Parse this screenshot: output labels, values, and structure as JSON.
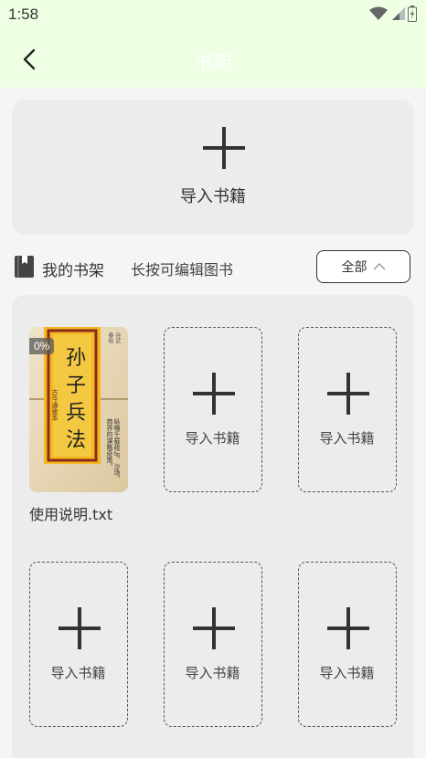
{
  "status_bar": {
    "time": "1:58"
  },
  "header": {
    "title": "书架"
  },
  "import_card": {
    "label": "导入书籍"
  },
  "shelf": {
    "title": "我的书架",
    "hint": "长按可编辑图书",
    "filter_label": "全部"
  },
  "books": [
    {
      "name": "使用说明.txt",
      "progress": "0%",
      "cover": {
        "title_chars": [
          "孙",
          "子",
          "兵",
          "法"
        ],
        "edition": "古今通鉴本",
        "author": "孙武",
        "blurb": "纵横千载政坛、沙场、商界的谋略奇策。",
        "dynasty": "春秋"
      }
    }
  ],
  "slots": [
    {
      "label": "导入书籍"
    },
    {
      "label": "导入书籍"
    },
    {
      "label": "导入书籍"
    },
    {
      "label": "导入书籍"
    },
    {
      "label": "导入书籍"
    }
  ],
  "colors": {
    "header_bg": "#efffe3",
    "card_bg": "#edecec",
    "page_bg": "#f5f5f5",
    "cover_gold": "#f2b820",
    "cover_red": "#8c2a1c"
  }
}
